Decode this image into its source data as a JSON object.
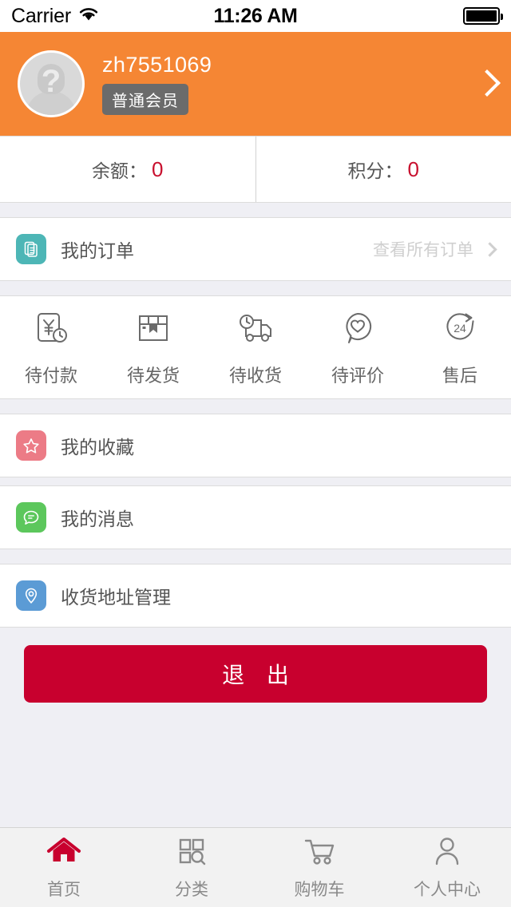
{
  "status_bar": {
    "carrier": "Carrier",
    "wifi_icon": "wifi-icon",
    "time": "11:26 AM",
    "battery_icon": "battery-full-icon"
  },
  "profile": {
    "avatar_icon": "avatar-placeholder-icon",
    "username": "zh7551069",
    "member_level": "普通会员",
    "arrow_icon": "chevron-right-icon",
    "accent_color": "#F58634"
  },
  "stats": [
    {
      "label": "余额：",
      "value": "0"
    },
    {
      "label": "积分：",
      "value": "0"
    }
  ],
  "orders": {
    "icon": "document-icon",
    "label": "我的订单",
    "link_text": "查看所有订单",
    "chevron_icon": "chevron-right-icon"
  },
  "order_status": [
    {
      "icon": "pending-payment-icon",
      "label": "待付款"
    },
    {
      "icon": "pending-shipment-icon",
      "label": "待发货"
    },
    {
      "icon": "pending-receipt-icon",
      "label": "待收货"
    },
    {
      "icon": "pending-review-icon",
      "label": "待评价"
    },
    {
      "icon": "after-sales-24-icon",
      "label": "售后",
      "badge_text": "24"
    }
  ],
  "menu": [
    {
      "icon": "star-icon",
      "label": "我的收藏",
      "color": "#ec7b86"
    },
    {
      "icon": "message-icon",
      "label": "我的消息",
      "color": "#5cc75c"
    }
  ],
  "address": {
    "icon": "location-pin-icon",
    "label": "收货地址管理",
    "color": "#5b9bd5"
  },
  "logout": {
    "label": "退 出",
    "color": "#c8002e"
  },
  "tabbar": [
    {
      "icon": "home-icon",
      "label": "首页",
      "active": true
    },
    {
      "icon": "category-icon",
      "label": "分类",
      "active": false
    },
    {
      "icon": "cart-icon",
      "label": "购物车",
      "active": false
    },
    {
      "icon": "user-icon",
      "label": "个人中心",
      "active": false
    }
  ]
}
